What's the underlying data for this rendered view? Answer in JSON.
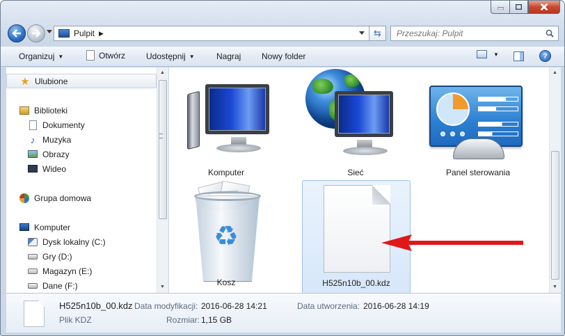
{
  "window": {
    "caption_buttons": {
      "minimize": "minimize",
      "maximize": "maximize",
      "close": "close"
    }
  },
  "address": {
    "location": "Pulpit",
    "separator": "▶"
  },
  "search": {
    "placeholder": "Przeszukaj: Pulpit"
  },
  "toolbar": {
    "organize": "Organizuj",
    "open": "Otwórz",
    "share": "Udostępnij",
    "burn": "Nagraj",
    "new_folder": "Nowy folder",
    "help": "?"
  },
  "nav": {
    "favorites": "Ulubione",
    "libraries": "Biblioteki",
    "documents": "Dokumenty",
    "music": "Muzyka",
    "pictures": "Obrazy",
    "video": "Wideo",
    "homegroup": "Grupa domowa",
    "computer": "Komputer",
    "drive_c": "Dysk lokalny (C:)",
    "drive_d": "Gry (D:)",
    "drive_e": "Magazyn (E:)",
    "drive_f": "Dane (F:)"
  },
  "items": {
    "computer": "Komputer",
    "network": "Sieć",
    "control_panel": "Panel sterowania",
    "recycle_bin": "Kosz",
    "file": "H525n10b_00.kdz"
  },
  "details": {
    "file_name": "H525n10b_00.kdz",
    "file_type": "Plik KDZ",
    "modified_label": "Data modyfikacji:",
    "modified_value": "2016-06-28 14:21",
    "created_label": "Data utworzenia:",
    "created_value": "2016-06-28 14:19",
    "size_label": "Rozmiar:",
    "size_value": "1,15 GB"
  },
  "colors": {
    "selection": "#d6e7fa",
    "arrow": "#e01818"
  }
}
